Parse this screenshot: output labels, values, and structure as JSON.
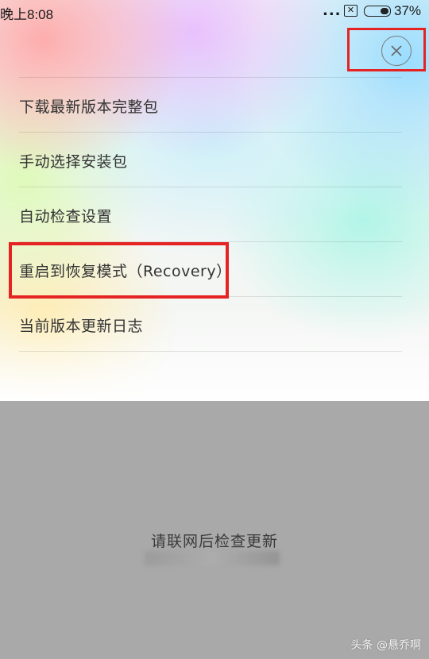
{
  "status_bar": {
    "time": "晚上8:08",
    "dots": "...",
    "sim_icon": "sim-card-x-icon",
    "battery_icon": "battery-icon",
    "battery_percent": "37%",
    "battery_level": 0.37
  },
  "close_icon": "close-icon",
  "menu": {
    "items": [
      {
        "label": "下载最新版本完整包"
      },
      {
        "label": "手动选择安装包"
      },
      {
        "label": "自动检查设置"
      },
      {
        "label": "重启到恢复模式（Recovery）"
      },
      {
        "label": "当前版本更新日志"
      }
    ]
  },
  "bottom": {
    "message": "请联网后检查更新"
  },
  "watermark": "头条 @悬乔啊",
  "colors": {
    "highlight": "#e52323",
    "overlay": "#a9a9a9"
  }
}
